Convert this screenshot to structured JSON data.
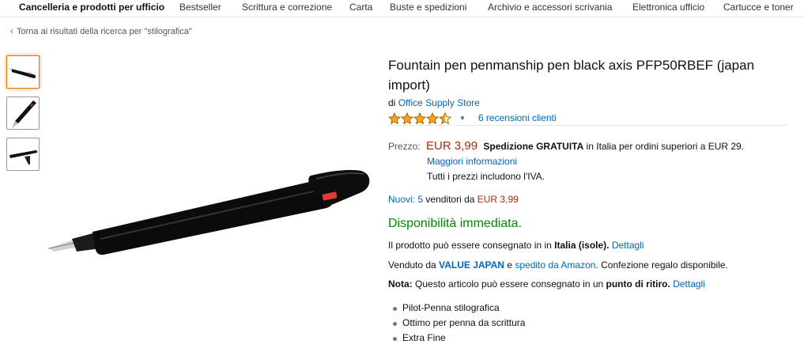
{
  "nav": {
    "items": [
      "Cancelleria e prodotti per ufficio",
      "Bestseller",
      "Scrittura e correzione",
      "Carta",
      "Buste e spedizioni",
      "Archivio e accessori scrivania",
      "Elettronica ufficio",
      "Cartucce e toner"
    ]
  },
  "back_link": "Torna ai risultati della ricerca per \"stilografica\"",
  "product": {
    "title": "Fountain pen penmanship pen black axis PFP50RBEF (japan import)",
    "by_prefix": "di",
    "brand": "Office Supply Store",
    "rating_value": 4.5,
    "rating_max": 5,
    "reviews": "6 recensioni clienti"
  },
  "price": {
    "label": "Prezzo:",
    "value": "EUR 3,99",
    "ship_bold": "Spedizione GRATUITA",
    "ship_rest": "in Italia per ordini superiori a EUR 29.",
    "more_info": "Maggiori informazioni",
    "iva": "Tutti i prezzi includono l'IVA."
  },
  "offers": {
    "link": "Nuovi: 5",
    "text": "venditori da",
    "price": "EUR 3,99"
  },
  "availability": "Disponibilità immediata.",
  "delivery": {
    "pre": "Il prodotto può essere consegnato in in",
    "bold": "Italia (isole).",
    "link": "Dettagli"
  },
  "sold_by": {
    "pre": "Venduto da",
    "seller": "VALUE JAPAN",
    "mid": "e",
    "shipped": "spedito da Amazon",
    "post": ". Confezione regalo disponibile."
  },
  "note": {
    "label": "Nota:",
    "pre": "Questo articolo può essere consegnato in un",
    "bold": "punto di ritiro.",
    "link": "Dettagli"
  },
  "bullets": [
    "Pilot-Penna stilografica",
    "Ottimo per penna da scrittura",
    "Extra Fine"
  ],
  "colors": {
    "link": "#0066c0",
    "price": "#b12704",
    "available": "#008a00",
    "star": "#ffa41c"
  },
  "icons": {
    "back": "chevron-left-icon",
    "rating_menu": "caret-down-icon"
  }
}
